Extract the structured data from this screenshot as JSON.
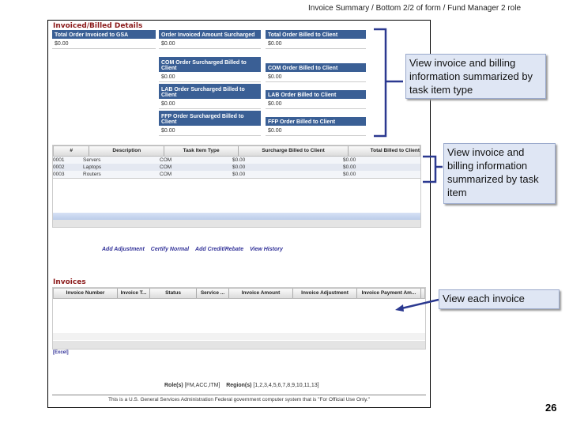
{
  "slide_title": "Invoice Summary / Bottom 2/2 of form / Fund Manager 2 role",
  "page_number": "26",
  "billed": {
    "title": "Invoiced/Billed Details",
    "boxes": [
      {
        "label": "Total Order Invoiced to GSA",
        "value": "$0.00"
      },
      {
        "label": "Order Invoiced Amount Surcharged",
        "value": "$0.00"
      },
      {
        "label": "Total Order Billed to Client",
        "value": "$0.00"
      },
      {
        "label": "COM Order Surcharged Billed to Client",
        "value": "$0.00"
      },
      {
        "label": "COM Order Billed to Client",
        "value": "$0.00"
      },
      {
        "label": "LAB Order Surcharged Billed to Client",
        "value": "$0.00"
      },
      {
        "label": "LAB Order Billed to Client",
        "value": "$0.00"
      },
      {
        "label": "FFP Order Surcharged Billed to Client",
        "value": "$0.00"
      },
      {
        "label": "FFP Order Billed to Client",
        "value": "$0.00"
      }
    ]
  },
  "task_table": {
    "columns": [
      "#",
      "Description",
      "Task Item Type",
      "Surcharge Billed to Client",
      "Total Billed to Client"
    ],
    "rows": [
      [
        "0001",
        "Servers",
        "COM",
        "$0.00",
        "$0.00"
      ],
      [
        "0002",
        "Laptops",
        "COM",
        "$0.00",
        "$0.00"
      ],
      [
        "0003",
        "Routers",
        "COM",
        "$0.00",
        "$0.00"
      ]
    ]
  },
  "links": [
    "Add Adjustment",
    "Certify Normal",
    "Add Credit/Rebate",
    "View History"
  ],
  "invoices": {
    "title": "Invoices",
    "columns": [
      "Invoice Number",
      "Invoice T...",
      "Status",
      "Service ...",
      "Invoice Amount",
      "Invoice Adjustment",
      "Invoice Payment Am..."
    ],
    "excel": "[Excel]"
  },
  "roles_label": "Role(s)",
  "roles_value": "[FM,ACC,ITM]",
  "regions_label": "Region(s)",
  "regions_value": "[1,2,3,4,5,6,7,8,9,10,11,13]",
  "footer": "This is a U.S. General Services Administration Federal government computer system that is \"For Official Use Only.\"",
  "callouts": [
    "View invoice and billing information summarized by task item type",
    "View invoice and billing information summarized by task item",
    "View each invoice"
  ]
}
